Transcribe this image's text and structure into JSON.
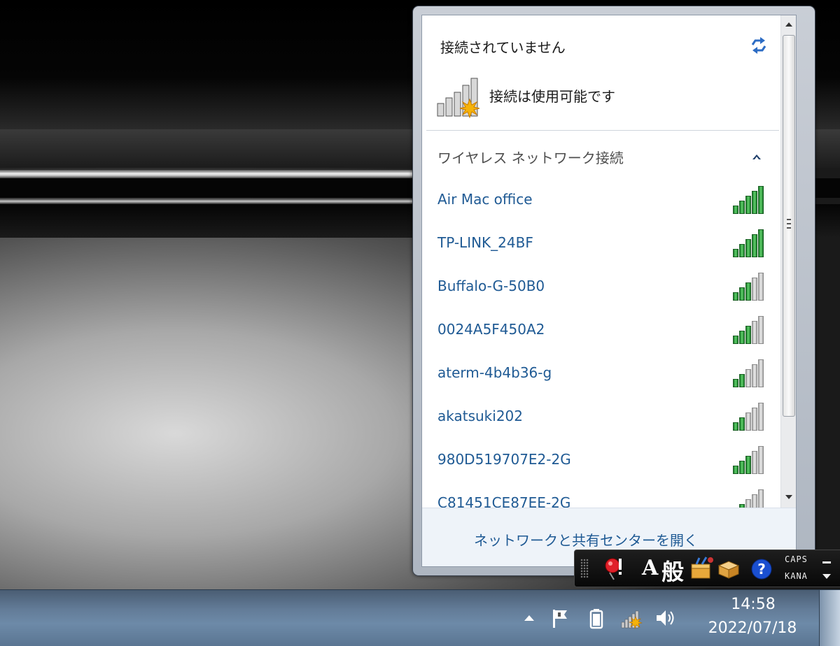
{
  "flyout": {
    "status_title": "接続されていません",
    "connection_status": "接続は使用可能です",
    "section_label": "ワイヤレス ネットワーク接続",
    "networks": [
      {
        "name": "Air Mac office",
        "signal": 5
      },
      {
        "name": "TP-LINK_24BF",
        "signal": 5
      },
      {
        "name": "Buffalo-G-50B0",
        "signal": 3
      },
      {
        "name": "0024A5F450A2",
        "signal": 3
      },
      {
        "name": "aterm-4b4b36-g",
        "signal": 2
      },
      {
        "name": "akatsuki202",
        "signal": 2
      },
      {
        "name": "980D519707E2-2G",
        "signal": 3
      },
      {
        "name": "C81451CE87EE-2G",
        "signal": 2
      }
    ],
    "footer_link": "ネットワークと共有センターを開く"
  },
  "ime_bar": {
    "input_mode": "A",
    "conversion_mode": "般",
    "caps_label": "CAPS",
    "kana_label": "KANA"
  },
  "taskbar": {
    "time": "14:58",
    "date": "2022/07/18"
  },
  "icons": {
    "refresh": "refresh-icon",
    "signal_unconnected": "wifi-available-icon",
    "tray": [
      "show-hidden-icons",
      "action-center-flag-icon",
      "battery-icon",
      "network-icon",
      "volume-icon"
    ]
  },
  "colors": {
    "link": "#1f5a94",
    "signal_on": "#3aa64a",
    "taskbar": "#637c98"
  }
}
